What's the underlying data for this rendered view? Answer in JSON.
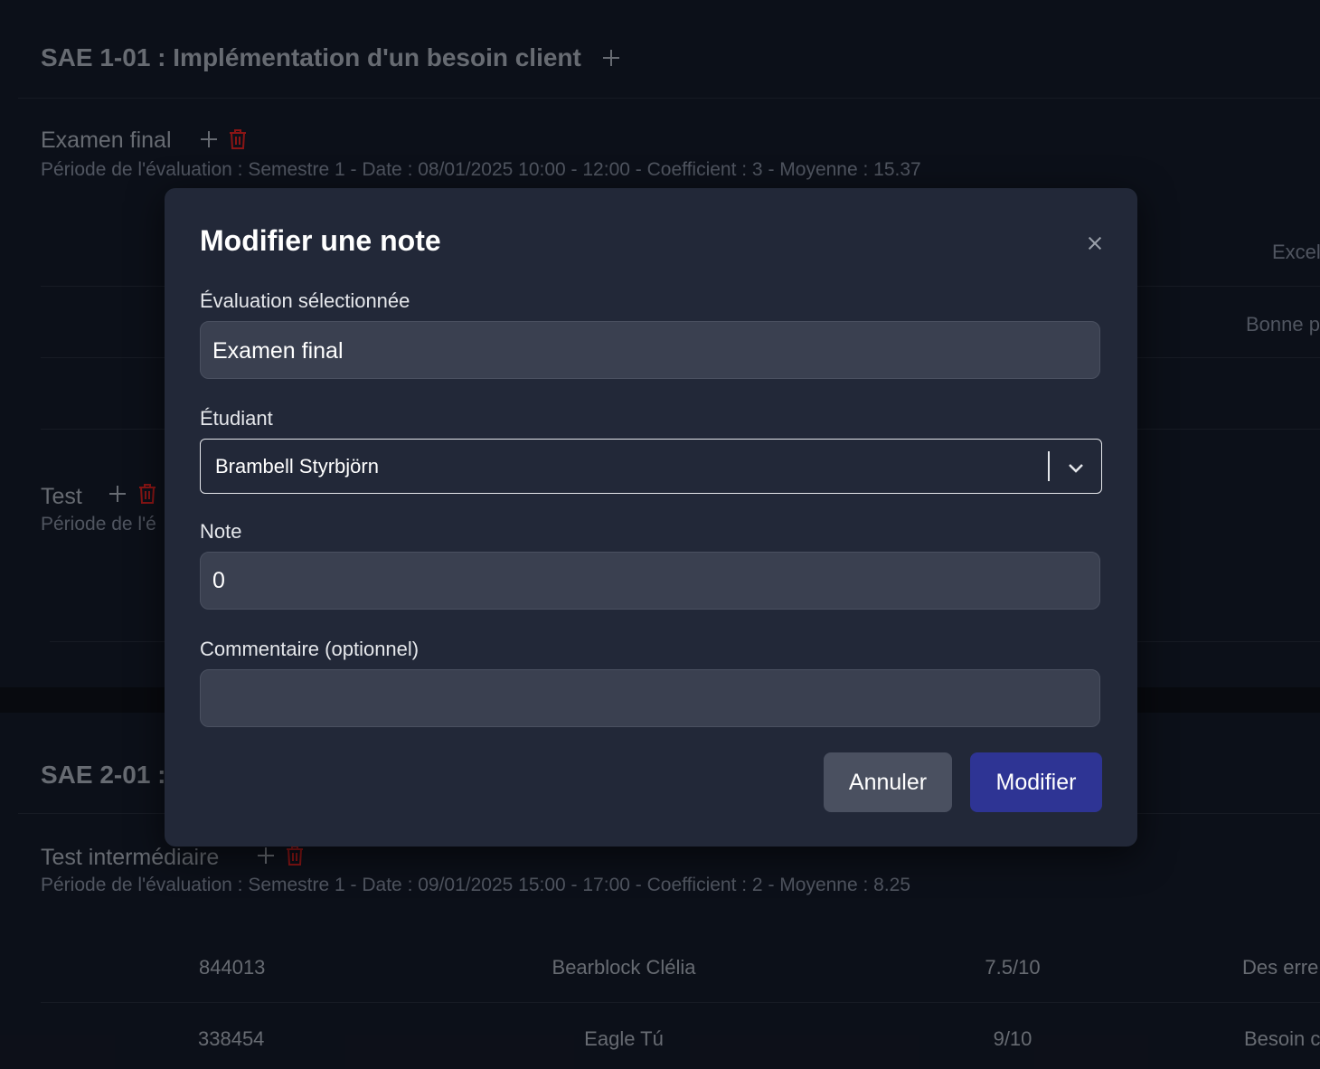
{
  "sections": [
    {
      "title": "SAE 1-01 : Implémentation d'un besoin client",
      "evaluations": [
        {
          "title": "Examen final",
          "meta": "Période de l'évaluation : Semestre 1 - Date : 08/01/2025 10:00 - 12:00 - Coefficient : 3  - Moyenne : 15.37",
          "row_comments": [
            "Excel",
            "Bonne p"
          ]
        },
        {
          "title": "Test",
          "meta": "Période de l'é"
        }
      ]
    },
    {
      "title": "SAE 2-01 :",
      "evaluations": [
        {
          "title": "Test intermédiaire",
          "meta": "Période de l'évaluation : Semestre 1 - Date : 09/01/2025 15:00 - 17:00 - Coefficient : 2  - Moyenne : 8.25",
          "rows": [
            {
              "id": "844013",
              "name": "Bearblock Clélia",
              "grade": "7.5/10",
              "comment": "Des erre"
            },
            {
              "id": "338454",
              "name": "Eagle Tú",
              "grade": "9/10",
              "comment": "Besoin c"
            }
          ]
        }
      ]
    }
  ],
  "modal": {
    "title": "Modifier une note",
    "close_icon": "close-icon",
    "evaluation_label": "Évaluation sélectionnée",
    "evaluation_value": "Examen final",
    "student_label": "Étudiant",
    "student_value": "Brambell Styrbjörn",
    "grade_label": "Note",
    "grade_value": "0",
    "comment_label": "Commentaire (optionnel)",
    "comment_value": "",
    "cancel_label": "Annuler",
    "submit_label": "Modifier"
  },
  "colors": {
    "background": "#0b0e15",
    "card": "#111622",
    "modal": "#222838",
    "danger": "#b91c1c",
    "primary": "#2e3494"
  }
}
